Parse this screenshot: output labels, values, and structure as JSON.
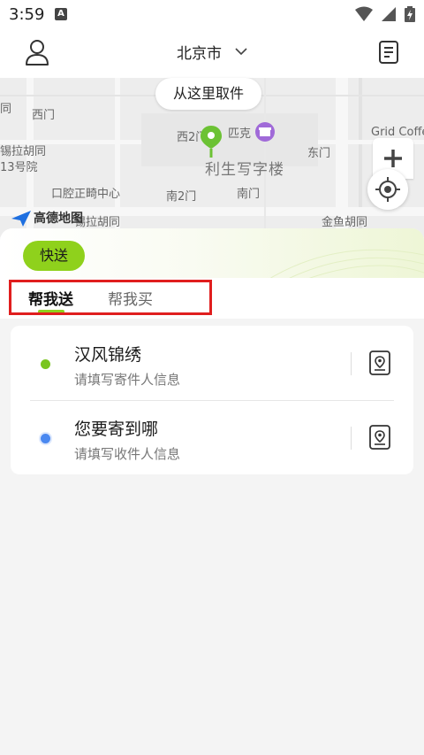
{
  "status_bar": {
    "time": "3:59",
    "notification_icon": "A"
  },
  "header": {
    "city": "北京市",
    "user_icon": "user-icon",
    "orders_icon": "document-list-icon"
  },
  "map": {
    "pickup_label": "从这里取件",
    "labels": {
      "l1": "同",
      "l2": "西门",
      "l3": "西2门",
      "l4": "匹克",
      "l5": "利生写字楼",
      "l6": "东门",
      "l7": "锡拉胡同",
      "l8": "13号院",
      "l9": "口腔正畸中心",
      "l10": "南2门",
      "l11": "南门",
      "l12": "锡拉胡同",
      "l13": "金鱼胡同",
      "l14": "Grid Coffe"
    },
    "logo_text": "高德地图"
  },
  "panel": {
    "express_tag": "快送",
    "tabs": [
      "帮我送",
      "帮我买"
    ],
    "active_tab": 0
  },
  "addresses": [
    {
      "title": "汉风锦绣",
      "subtitle": "请填写寄件人信息",
      "dot_color": "#7ac520"
    },
    {
      "title": "您要寄到哪",
      "subtitle": "请填写收件人信息",
      "dot_color": "#4a88f0"
    }
  ],
  "colors": {
    "accent": "#8fd11c",
    "highlight": "#e01e1e",
    "pin": "#6cc234"
  }
}
